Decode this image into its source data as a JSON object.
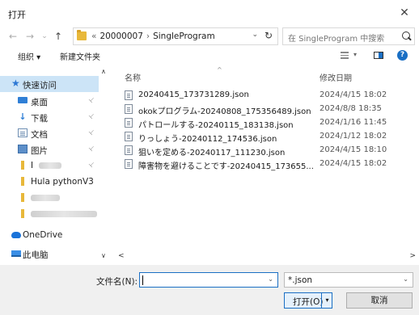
{
  "window": {
    "title": "打开",
    "close_glyph": "✕"
  },
  "nav": {
    "back": "←",
    "forward": "→",
    "recent": "⌄",
    "up": "↑"
  },
  "address": {
    "overflow": "«",
    "crumbs": [
      "20000007",
      "SingleProgram"
    ],
    "separator": "›",
    "dropdown": "⌄",
    "refresh": "↻"
  },
  "search": {
    "placeholder": "在 SingleProgram 中搜索"
  },
  "toolbar": {
    "organize_label": "组织 ▾",
    "new_folder_label": "新建文件夹",
    "view_dropdown": "▾",
    "help": "?"
  },
  "sidebar": {
    "items": [
      {
        "label": "快速访问",
        "icon": "star-icon"
      },
      {
        "label": "桌面",
        "icon": "desktop-icon",
        "pinned": true
      },
      {
        "label": "下载",
        "icon": "download-icon",
        "pinned": true
      },
      {
        "label": "文档",
        "icon": "documents-icon",
        "pinned": true
      },
      {
        "label": "图片",
        "icon": "pictures-icon",
        "pinned": true
      },
      {
        "label": "I",
        "icon": "folder-icon",
        "pinned": true
      },
      {
        "label": "Hula pythonV3",
        "icon": "folder-icon"
      },
      {
        "label": "",
        "icon": "folder-icon"
      },
      {
        "label": "",
        "icon": "folder-icon"
      },
      {
        "label": "OneDrive",
        "icon": "onedrive-icon"
      },
      {
        "label": "此电脑",
        "icon": "computer-icon"
      }
    ],
    "pin_glyph": "📌",
    "scroll_up": "∧",
    "scroll_down": "∨"
  },
  "filelist": {
    "columns": {
      "name": "名称",
      "date": "修改日期"
    },
    "sort_indicator": "^",
    "rows": [
      {
        "name": "20240415_173731289.json",
        "date": "2024/4/15 18:02"
      },
      {
        "name": "okokプログラム-20240808_175356489.json",
        "date": "2024/8/8 18:35"
      },
      {
        "name": "パトロールする-20240115_183138.json",
        "date": "2024/1/16 11:45"
      },
      {
        "name": "りっしょう-20240112_174536.json",
        "date": "2024/1/12 18:02"
      },
      {
        "name": "狙いを定める-20240117_111230.json",
        "date": "2024/4/15 18:10"
      },
      {
        "name": "障害物を避けることです-20240415_173655...",
        "date": "2024/4/15 18:02"
      }
    ],
    "scroll_left": "<",
    "scroll_right": ">"
  },
  "bottom": {
    "filename_label": "文件名(N):",
    "filename_value": "",
    "filename_dropdown": "⌄",
    "filetype_value": "*.json",
    "filetype_dropdown": "⌄",
    "open_label": "打开(O)",
    "open_split": "▾",
    "cancel_label": "取消"
  },
  "colors": {
    "accent": "#1a6fc4",
    "selection": "#cce4f7",
    "folder": "#e8b83a"
  }
}
